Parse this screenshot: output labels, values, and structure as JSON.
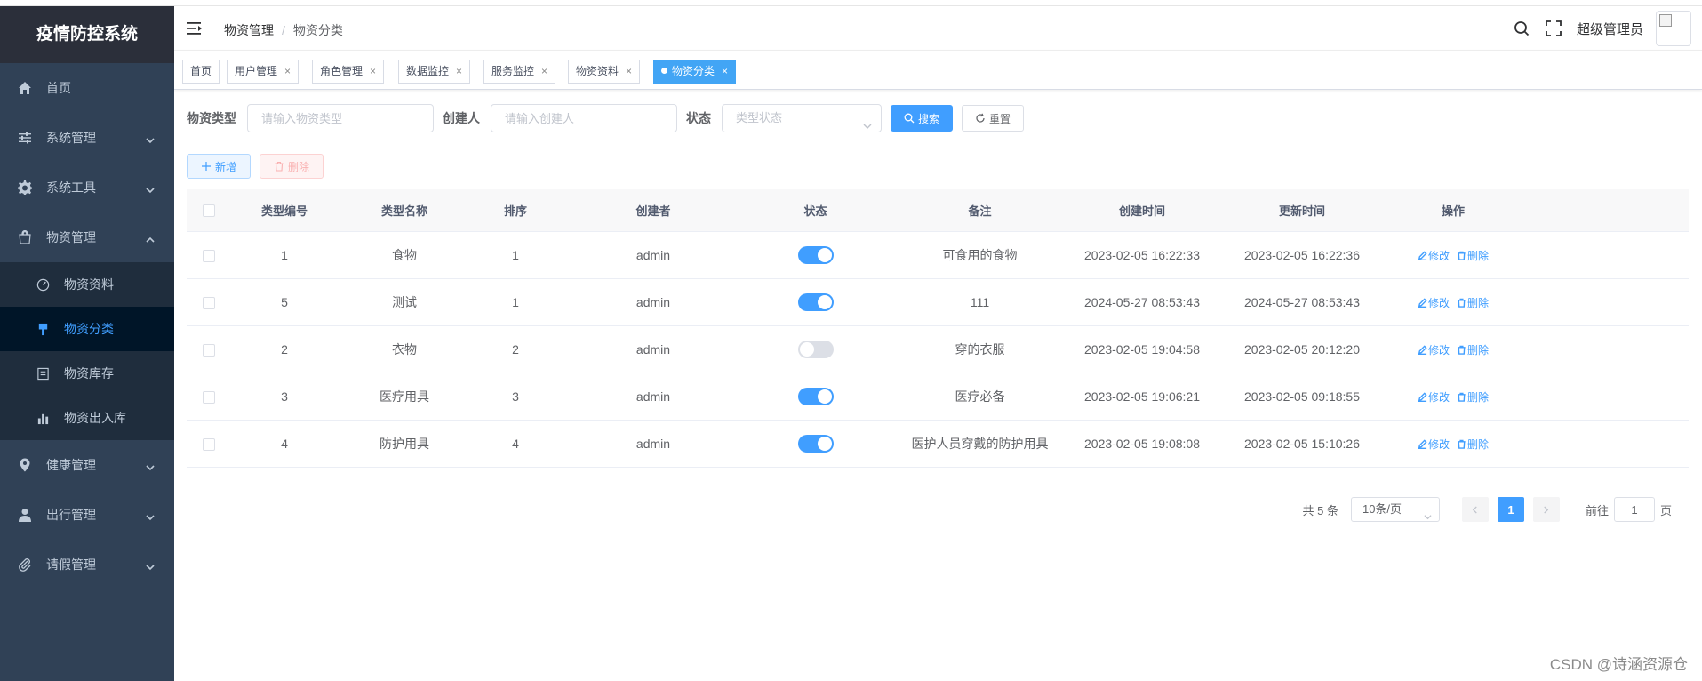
{
  "app": {
    "title": "疫情防控系统"
  },
  "sidebar": {
    "items": [
      {
        "label": "首页",
        "icon": "home-icon"
      },
      {
        "label": "系统管理",
        "icon": "sliders-icon"
      },
      {
        "label": "系统工具",
        "icon": "gear-icon"
      },
      {
        "label": "物资管理",
        "icon": "bag-icon",
        "expanded": true
      },
      {
        "label": "健康管理",
        "icon": "location-icon"
      },
      {
        "label": "出行管理",
        "icon": "user-icon"
      },
      {
        "label": "请假管理",
        "icon": "paperclip-icon"
      }
    ],
    "submenu": [
      {
        "label": "物资资料",
        "icon": "dashboard-icon"
      },
      {
        "label": "物资分类",
        "icon": "brush-icon",
        "active": true
      },
      {
        "label": "物资库存",
        "icon": "document-icon"
      },
      {
        "label": "物资出入库",
        "icon": "bar-chart-icon"
      }
    ]
  },
  "navbar": {
    "breadcrumb": [
      "物资管理",
      "物资分类"
    ],
    "user_name": "超级管理员"
  },
  "tags": [
    "首页",
    "用户管理",
    "角色管理",
    "数据监控",
    "服务监控",
    "物资资料",
    "物资分类"
  ],
  "search": {
    "type_label": "物资类型",
    "type_placeholder": "请输入物资类型",
    "creator_label": "创建人",
    "creator_placeholder": "请输入创建人",
    "status_label": "状态",
    "status_placeholder": "类型状态",
    "search_button": "搜索",
    "reset_button": "重置"
  },
  "actions": {
    "add": "新增",
    "delete": "删除"
  },
  "table": {
    "headers": [
      "类型编号",
      "类型名称",
      "排序",
      "创建者",
      "状态",
      "备注",
      "创建时间",
      "更新时间",
      "操作"
    ],
    "rows": [
      {
        "id": "1",
        "name": "食物",
        "sort": "1",
        "creator": "admin",
        "status": true,
        "remark": "可食用的食物",
        "created": "2023-02-05 16:22:33",
        "updated": "2023-02-05 16:22:36"
      },
      {
        "id": "5",
        "name": "测试",
        "sort": "1",
        "creator": "admin",
        "status": true,
        "remark": "111",
        "created": "2024-05-27 08:53:43",
        "updated": "2024-05-27 08:53:43"
      },
      {
        "id": "2",
        "name": "衣物",
        "sort": "2",
        "creator": "admin",
        "status": false,
        "remark": "穿的衣服",
        "created": "2023-02-05 19:04:58",
        "updated": "2023-02-05 20:12:20"
      },
      {
        "id": "3",
        "name": "医疗用具",
        "sort": "3",
        "creator": "admin",
        "status": true,
        "remark": "医疗必备",
        "created": "2023-02-05 19:06:21",
        "updated": "2023-02-05 09:18:55"
      },
      {
        "id": "4",
        "name": "防护用具",
        "sort": "4",
        "creator": "admin",
        "status": true,
        "remark": "医护人员穿戴的防护用具",
        "created": "2023-02-05 19:08:08",
        "updated": "2023-02-05 15:10:26"
      }
    ],
    "op_edit": "修改",
    "op_delete": "删除"
  },
  "pagination": {
    "total": "共 5 条",
    "page_size": "10条/页",
    "current": "1",
    "goto_label": "前往",
    "goto_value": "1",
    "page_suffix": "页"
  },
  "watermark": "CSDN @诗涵资源仓",
  "colors": {
    "primary": "#409eff",
    "sidebar_bg": "#304156",
    "submenu_bg": "#1f2d3d",
    "active_bg": "#001528"
  }
}
